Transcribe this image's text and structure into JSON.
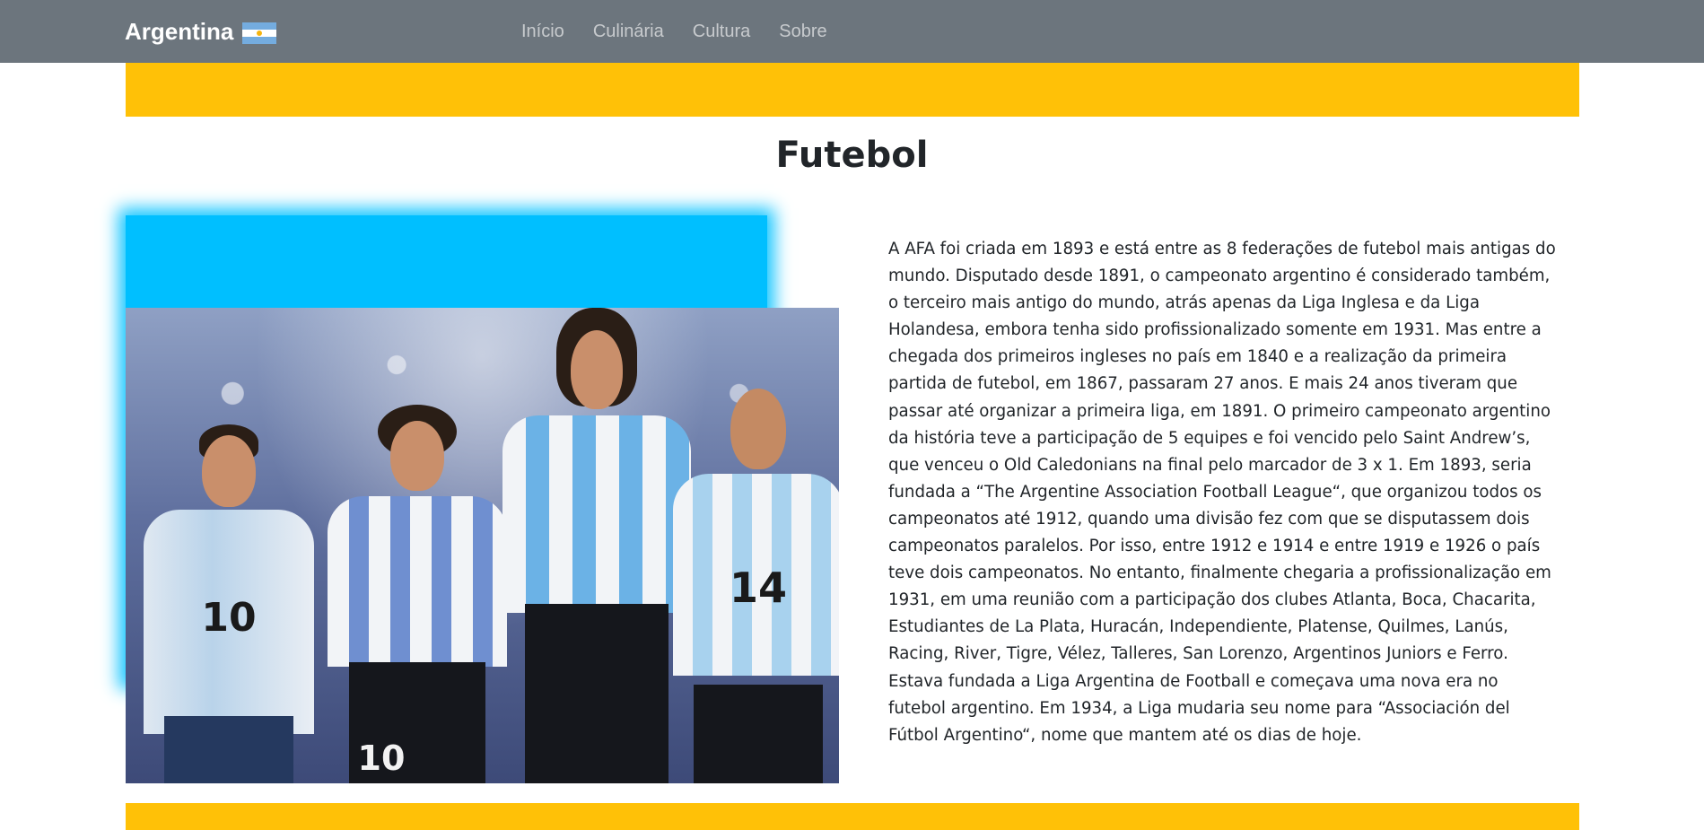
{
  "navbar": {
    "brand": "Argentina",
    "links": [
      "Início",
      "Culinária",
      "Cultura",
      "Sobre"
    ],
    "background": "#6c757d"
  },
  "accent": "#ffc107",
  "glow_color": "#00bfff",
  "page_title": "Futebol",
  "image": {
    "subject": "four Argentina national team players in stadium",
    "jersey_numbers": [
      "10",
      "10",
      "14"
    ]
  },
  "body_text": "A AFA foi criada em 1893 e está entre as 8 federações de futebol mais antigas do mundo. Disputado desde 1891, o campeonato argentino é considerado também, o terceiro mais antigo do mundo, atrás apenas da Liga Inglesa e da Liga Holandesa, embora tenha sido profissionalizado somente em 1931. Mas entre a chegada dos primeiros ingleses no país em 1840 e a realização da primeira partida de futebol, em 1867, passaram 27 anos. E mais 24 anos tiveram que passar até organizar a primeira liga, em 1891. O primeiro campeonato argentino da história teve a participação de 5 equipes e foi vencido pelo Saint Andrew’s, que venceu o Old Caledonians na final pelo marcador de 3 x 1. Em 1893, seria fundada a “The Argentine Association Football League“, que organizou todos os campeonatos até 1912, quando uma divisão fez com que se disputassem dois campeonatos paralelos. Por isso, entre 1912 e 1914 e entre 1919 e 1926 o país teve dois campeonatos. No entanto, finalmente chegaria a profissionalização em 1931, em uma reunião com a participação dos clubes Atlanta, Boca, Chacarita, Estudiantes de La Plata, Huracán, Independiente, Platense, Quilmes, Lanús, Racing, River, Tigre, Vélez, Talleres, San Lorenzo, Argentinos Juniors e Ferro. Estava fundada a Liga Argentina de Football e começava uma nova era no futebol argentino. Em 1934, a Liga mudaria seu nome para “Associación del Fútbol Argentino“, nome que mantem até os dias de hoje."
}
